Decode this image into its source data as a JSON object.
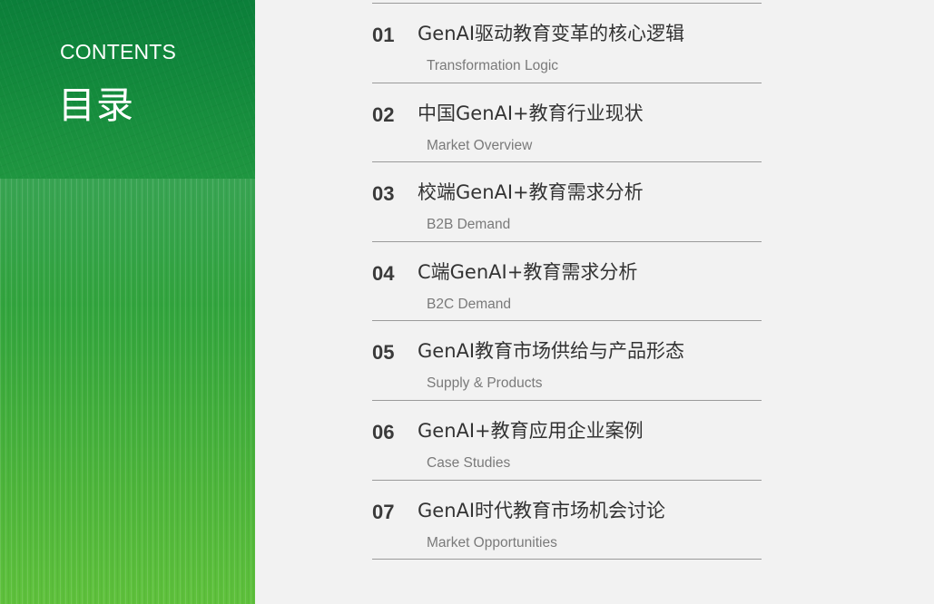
{
  "sidebar": {
    "heading_en": "CONTENTS",
    "heading_zh": "目录"
  },
  "toc": [
    {
      "number": "01",
      "title": "GenAI驱动教育变革的核心逻辑",
      "subtitle": "Transformation Logic"
    },
    {
      "number": "02",
      "title": "中国GenAI+教育行业现状",
      "subtitle": "Market Overview"
    },
    {
      "number": "03",
      "title": "校端GenAI+教育需求分析",
      "subtitle": "B2B Demand"
    },
    {
      "number": "04",
      "title": "C端GenAI+教育需求分析",
      "subtitle": "B2C Demand"
    },
    {
      "number": "05",
      "title": "GenAI教育市场供给与产品形态",
      "subtitle": "Supply & Products"
    },
    {
      "number": "06",
      "title": "GenAI+教育应用企业案例",
      "subtitle": "Case Studies"
    },
    {
      "number": "07",
      "title": "GenAI时代教育市场机会讨论",
      "subtitle": "Market Opportunities"
    }
  ],
  "colors": {
    "accent_green": "#2ea03e",
    "background": "#f2f2f2",
    "divider": "#9a9a9a"
  }
}
